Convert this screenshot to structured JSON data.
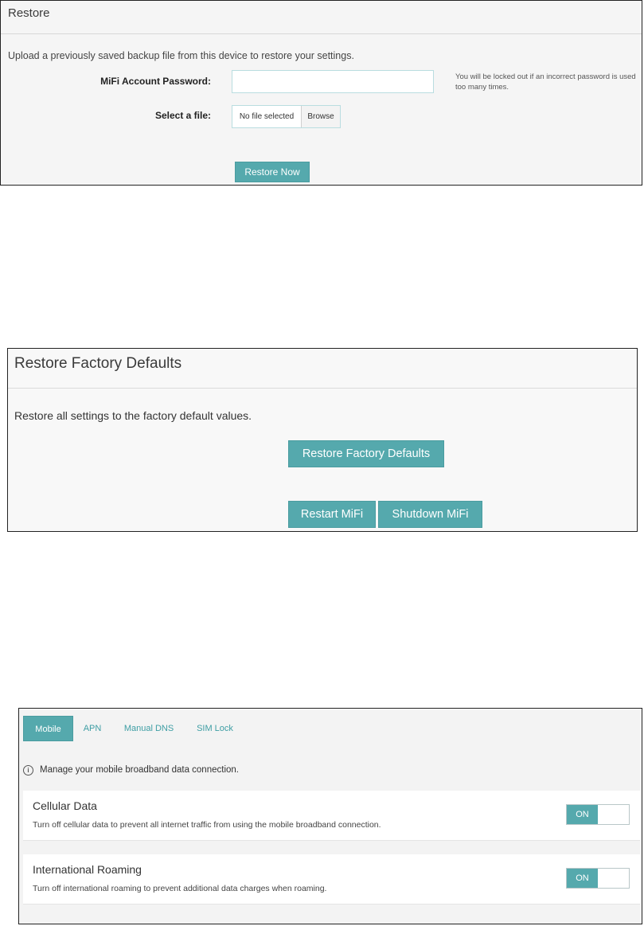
{
  "restore": {
    "title": "Restore",
    "description": "Upload a previously saved backup file from this device to restore your settings.",
    "password_label": "MiFi Account Password:",
    "password_value": "",
    "lock_note": "You will be locked out if an incorrect password is used too many times.",
    "file_label": "Select a file:",
    "file_status": "No file selected",
    "browse_label": "Browse",
    "restore_now_label": "Restore Now"
  },
  "factory": {
    "title": "Restore Factory Defaults",
    "description": "Restore all settings to the factory default values.",
    "restore_defaults_label": "Restore Factory Defaults",
    "restart_label": "Restart MiFi",
    "shutdown_label": "Shutdown MiFi"
  },
  "mobile": {
    "tabs": [
      {
        "label": "Mobile",
        "active": true
      },
      {
        "label": "APN",
        "active": false
      },
      {
        "label": "Manual DNS",
        "active": false
      },
      {
        "label": "SIM Lock",
        "active": false
      }
    ],
    "info_icon": "info-icon",
    "info_text": "Manage your mobile broadband data connection.",
    "cellular": {
      "title": "Cellular Data",
      "description": "Turn off cellular data to prevent all internet traffic from using the mobile broadband connection.",
      "state": "ON"
    },
    "roaming": {
      "title": "International Roaming",
      "description": "Turn off international roaming to prevent additional data charges when roaming.",
      "state": "ON"
    }
  },
  "colors": {
    "accent": "#55a9ad",
    "tab_link": "#3e9ea4"
  }
}
